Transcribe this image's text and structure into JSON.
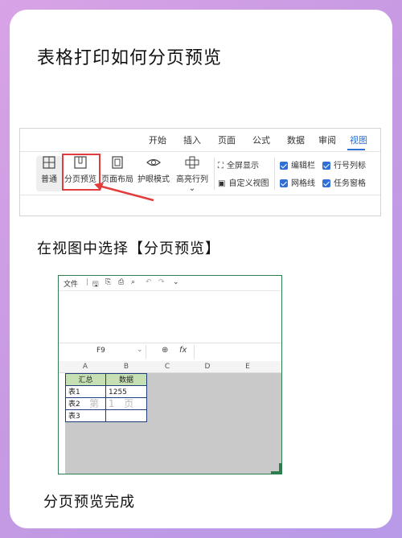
{
  "title": "表格打印如何分页预览",
  "step1_caption": "在视图中选择【分页预览】",
  "step2_caption": "分页预览完成",
  "ribbon": {
    "tabs": [
      "开始",
      "插入",
      "页面",
      "公式",
      "数据",
      "审阅",
      "视图"
    ],
    "active_tab": "视图",
    "buttons": {
      "normal": "普通",
      "page_break_preview": "分页预览",
      "page_layout": "页面布局",
      "eye_protection": "护眼模式",
      "highlight_rowcol": "高亮行列",
      "fullscreen": "全屏显示",
      "custom_view": "自定义视图"
    },
    "checkboxes": {
      "formula_bar": "编辑栏",
      "row_col_headers": "行号列标",
      "gridlines": "网格线",
      "taskpane": "任务窗格"
    }
  },
  "sheet": {
    "menu_file": "文件",
    "name_box": "F9",
    "fx_label": "fx",
    "columns": [
      "A",
      "B",
      "C",
      "D",
      "E"
    ],
    "table_headers": [
      "汇总",
      "数据"
    ],
    "rows": [
      [
        "表1",
        "1255"
      ],
      [
        "表2",
        ""
      ],
      [
        "表3",
        ""
      ]
    ],
    "page_watermark": "第 1 页"
  },
  "colors": {
    "accent": "#2f6fd6",
    "highlight_box": "#e23d3d",
    "table_header_fill": "#c6e0b4",
    "sheet_border": "#2e7d4f"
  }
}
